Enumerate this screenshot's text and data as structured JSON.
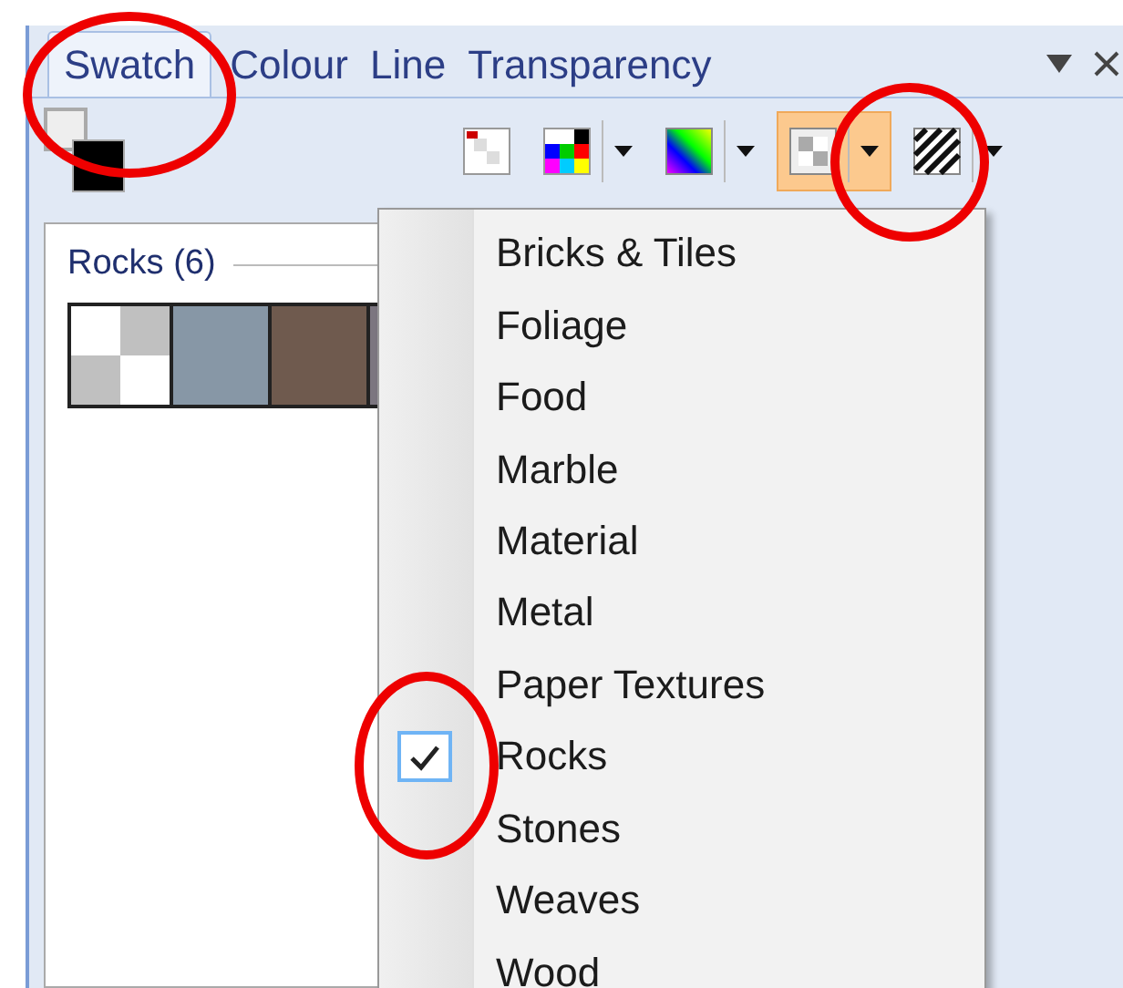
{
  "tabs": [
    {
      "label": "Swatch",
      "selected": true
    },
    {
      "label": "Colour",
      "selected": false
    },
    {
      "label": "Line",
      "selected": false
    },
    {
      "label": "Transparency",
      "selected": false
    }
  ],
  "toolbar": [
    {
      "kind": "none",
      "dropdown": false,
      "selected": false
    },
    {
      "kind": "palette",
      "dropdown": true,
      "selected": false
    },
    {
      "kind": "gradient",
      "dropdown": true,
      "selected": false
    },
    {
      "kind": "texture",
      "dropdown": true,
      "selected": true
    },
    {
      "kind": "hatch",
      "dropdown": true,
      "selected": false
    }
  ],
  "gallery": {
    "heading": "Rocks (6)"
  },
  "menu": {
    "items": [
      {
        "label": "Bricks & Tiles",
        "checked": false
      },
      {
        "label": "Foliage",
        "checked": false
      },
      {
        "label": "Food",
        "checked": false
      },
      {
        "label": "Marble",
        "checked": false
      },
      {
        "label": "Material",
        "checked": false
      },
      {
        "label": "Metal",
        "checked": false
      },
      {
        "label": "Paper Textures",
        "checked": false
      },
      {
        "label": "Rocks",
        "checked": true
      },
      {
        "label": "Stones",
        "checked": false
      },
      {
        "label": "Weaves",
        "checked": false
      },
      {
        "label": "Wood",
        "checked": false
      }
    ]
  }
}
